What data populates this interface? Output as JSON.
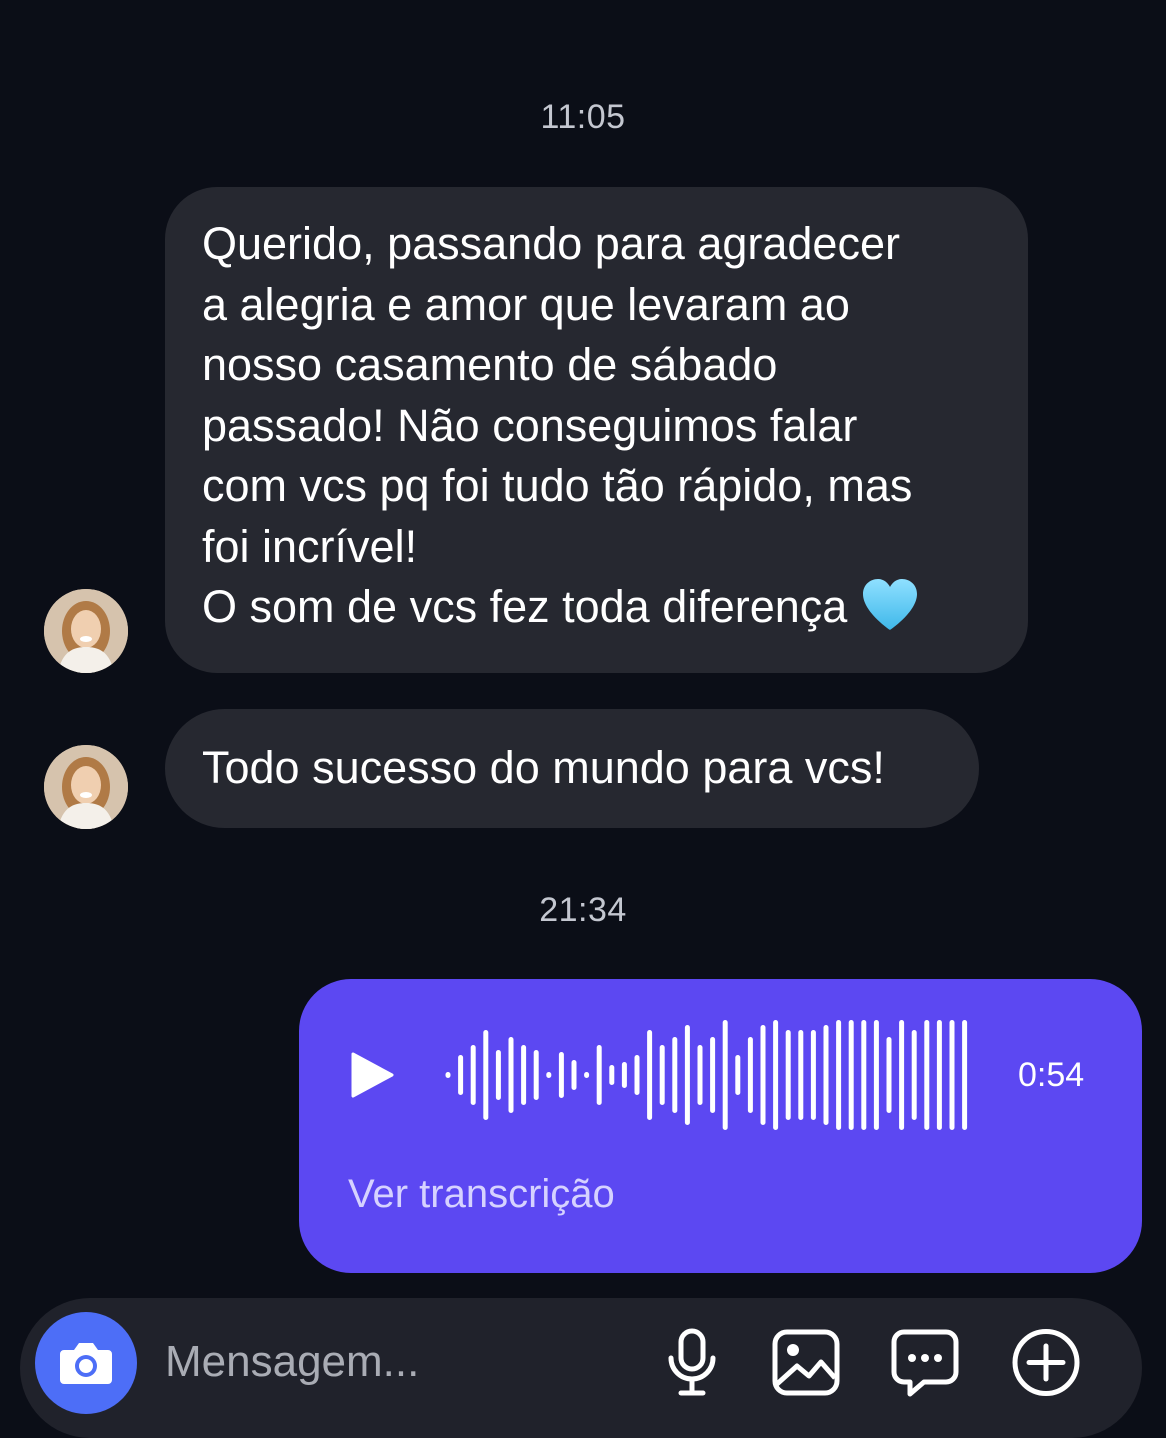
{
  "thread": {
    "timestamps": [
      "11:05",
      "21:34"
    ],
    "incoming": {
      "message1_lines": [
        "Querido, passando para agradecer",
        "a alegria e amor que levaram ao",
        "nosso casamento de sábado",
        "passado! Não conseguimos falar",
        "com vcs pq foi tudo tão rápido, mas",
        "foi incrível!",
        "O som de vcs fez toda diferença"
      ],
      "message1_emoji": "light-blue-heart",
      "message2": "Todo sucesso do mundo para vcs!"
    },
    "voice_message": {
      "duration": "0:54",
      "transcription_link": "Ver transcrição",
      "icon": "play-icon",
      "bubble_color": "#5c48f2"
    }
  },
  "composer": {
    "placeholder": "Mensagem...",
    "icons": [
      "camera-icon",
      "microphone-icon",
      "gallery-icon",
      "sticker-chat-icon",
      "plus-icon"
    ],
    "camera_color": "#4d6ef7"
  }
}
